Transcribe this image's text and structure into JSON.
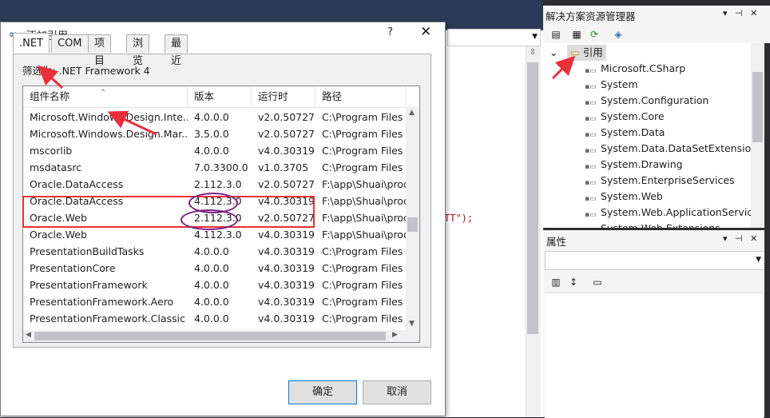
{
  "editor": {
    "code_fragment": "TT\");"
  },
  "dialog": {
    "title": "添加引用",
    "help": "?",
    "close": "✕",
    "tabs": [
      ".NET",
      "COM",
      "项目",
      "浏览",
      "最近"
    ],
    "filter_label": "筛选为: .NET Framework 4",
    "columns": [
      "组件名称",
      "版本",
      "运行时",
      "路径"
    ],
    "rows": [
      {
        "name": "Microsoft.Windows.Design.Inte...",
        "version": "4.0.0.0",
        "runtime": "v2.0.50727",
        "path": "C:\\Program Files (x"
      },
      {
        "name": "Microsoft.Windows.Design.Mar...",
        "version": "3.5.0.0",
        "runtime": "v2.0.50727",
        "path": "C:\\Program Files (x"
      },
      {
        "name": "mscorlib",
        "version": "4.0.0.0",
        "runtime": "v4.0.30319",
        "path": "C:\\Program Files (x"
      },
      {
        "name": "msdatasrc",
        "version": "7.0.3300.0",
        "runtime": "v1.0.3705",
        "path": "C:\\Program Files (x"
      },
      {
        "name": "Oracle.DataAccess",
        "version": "2.112.3.0",
        "runtime": "v2.0.50727",
        "path": "F:\\app\\Shuai\\produ"
      },
      {
        "name": "Oracle.DataAccess",
        "version": "4.112.3.0",
        "runtime": "v4.0.30319",
        "path": "F:\\app\\Shuai\\produ"
      },
      {
        "name": "Oracle.Web",
        "version": "2.112.3.0",
        "runtime": "v2.0.50727",
        "path": "F:\\app\\Shuai\\produ"
      },
      {
        "name": "Oracle.Web",
        "version": "4.112.3.0",
        "runtime": "v4.0.30319",
        "path": "F:\\app\\Shuai\\produ"
      },
      {
        "name": "PresentationBuildTasks",
        "version": "4.0.0.0",
        "runtime": "v4.0.30319",
        "path": "C:\\Program Files (x"
      },
      {
        "name": "PresentationCore",
        "version": "4.0.0.0",
        "runtime": "v4.0.30319",
        "path": "C:\\Program Files (x"
      },
      {
        "name": "PresentationFramework",
        "version": "4.0.0.0",
        "runtime": "v4.0.30319",
        "path": "C:\\Program Files (x"
      },
      {
        "name": "PresentationFramework.Aero",
        "version": "4.0.0.0",
        "runtime": "v4.0.30319",
        "path": "C:\\Program Files (x"
      },
      {
        "name": "PresentationFramework.Classic",
        "version": "4.0.0.0",
        "runtime": "v4.0.30319",
        "path": "C:\\Program Files (x"
      }
    ],
    "ok_label": "确定",
    "cancel_label": "取消"
  },
  "solution_explorer": {
    "title": "解决方案资源管理器",
    "title_buttons": "▾ ⊣ ✕",
    "root": "引用",
    "items": [
      "Microsoft.CSharp",
      "System",
      "System.Configuration",
      "System.Core",
      "System.Data",
      "System.Data.DataSetExtensions",
      "System.Drawing",
      "System.EnterpriseServices",
      "System.Web",
      "System.Web.ApplicationServices",
      "System.Web.Extensions"
    ]
  },
  "properties": {
    "title": "属性",
    "title_buttons": "▾ ⊣ ✕"
  },
  "colors": {
    "highlight_box": "#e8303a",
    "version_oval": "#7b1f82",
    "annotation_arrow": "#e8303a",
    "ide_chrome": "#2d2d30"
  },
  "icons": [
    "link-icon",
    "chevron-down-icon",
    "folder-icon",
    "reference-icon",
    "sort-arrow-icon"
  ]
}
